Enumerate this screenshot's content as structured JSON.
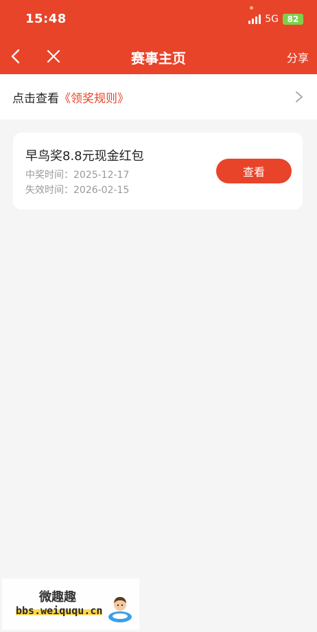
{
  "status_bar": {
    "time": "15:48",
    "network": "5G",
    "battery": "82"
  },
  "nav": {
    "title": "赛事主页",
    "share_label": "分享"
  },
  "rules_bar": {
    "prefix": "点击查看",
    "link": "《领奖规则》"
  },
  "prize_card": {
    "title": "早鸟奖8.8元现金红包",
    "win_time_label": "中奖时间：",
    "win_time": "2025-12-17",
    "expire_time_label": "失效时间：",
    "expire_time": "2026-02-15",
    "button_label": "查看"
  },
  "watermark": {
    "title": "微趣趣",
    "url": "bbs.weiququ.cn"
  },
  "colors": {
    "accent": "#e8442a",
    "background": "#f5f5f5",
    "battery": "#7ed04b"
  }
}
